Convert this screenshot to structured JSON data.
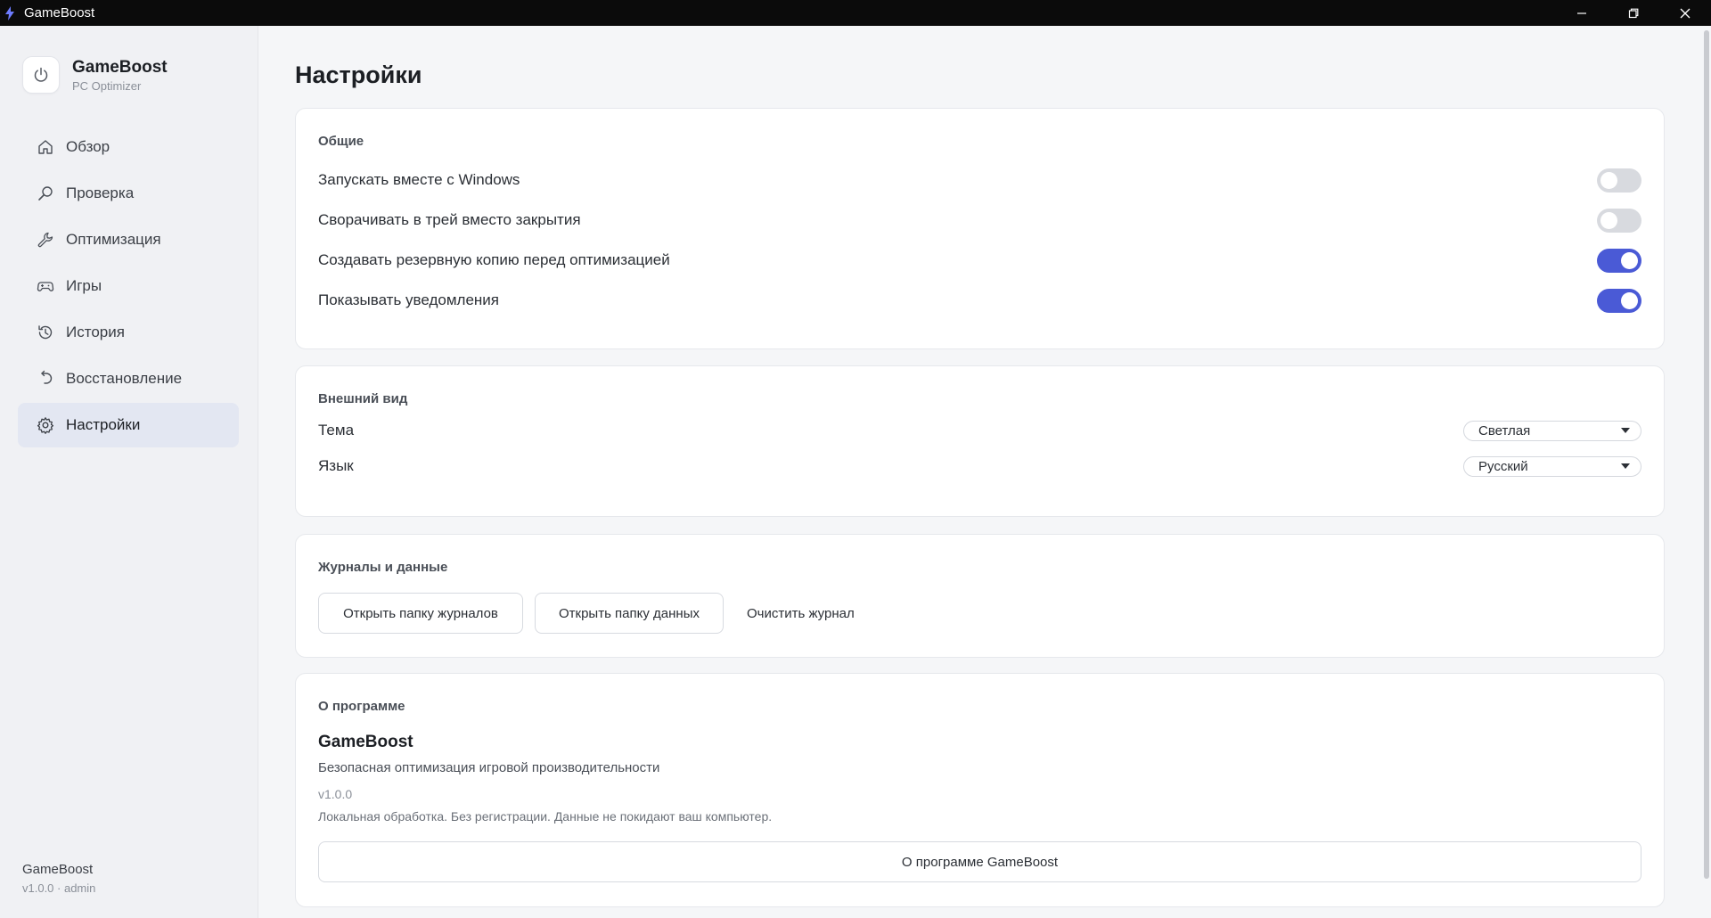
{
  "window": {
    "title": "GameBoost"
  },
  "brand": {
    "name": "GameBoost",
    "subtitle": "PC Optimizer"
  },
  "nav": [
    {
      "label": "Обзор",
      "icon": "home-icon"
    },
    {
      "label": "Проверка",
      "icon": "search-icon"
    },
    {
      "label": "Оптимизация",
      "icon": "wrench-icon"
    },
    {
      "label": "Игры",
      "icon": "gamepad-icon"
    },
    {
      "label": "История",
      "icon": "history-icon"
    },
    {
      "label": "Восстановление",
      "icon": "undo-icon"
    },
    {
      "label": "Настройки",
      "icon": "gear-icon",
      "active": true
    }
  ],
  "sidebar_footer": {
    "name": "GameBoost",
    "version": "v1.0.0 · admin"
  },
  "page": {
    "title": "Настройки"
  },
  "general": {
    "title": "Общие",
    "items": [
      {
        "label": "Запускать вместе с Windows",
        "enabled": false
      },
      {
        "label": "Сворачивать в трей вместо закрытия",
        "enabled": false
      },
      {
        "label": "Создавать резервную копию перед оптимизацией",
        "enabled": true
      },
      {
        "label": "Показывать уведомления",
        "enabled": true
      }
    ]
  },
  "appearance": {
    "title": "Внешний вид",
    "theme_label": "Тема",
    "theme_value": "Светлая",
    "language_label": "Язык",
    "language_value": "Русский"
  },
  "logs": {
    "title": "Журналы и данные",
    "open_logs": "Открыть папку журналов",
    "open_data": "Открыть папку данных",
    "clear_log": "Очистить журнал"
  },
  "about": {
    "title": "О программе",
    "name": "GameBoost",
    "description": "Безопасная оптимизация игровой производительности",
    "version": "v1.0.0",
    "note": "Локальная обработка. Без регистрации. Данные не покидают ваш компьютер.",
    "button": "О программе GameBoost"
  },
  "colors": {
    "accent": "#4a5ad6",
    "nav_active_bg": "#e3e7f2",
    "titlebar_bg": "#0b0b0b"
  }
}
